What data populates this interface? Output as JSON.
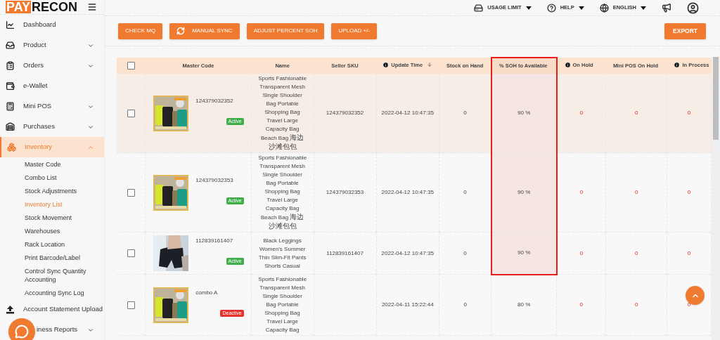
{
  "logo": {
    "part_1": "PAY",
    "part_2": "RECON"
  },
  "topbar": {
    "menus": [
      {
        "label": "USAGE LIMIT"
      },
      {
        "label": "HELP"
      },
      {
        "label": "ENGLISH"
      }
    ]
  },
  "sidebar": {
    "items": [
      {
        "label": "Dashboard",
        "expandable": false,
        "expanded": false,
        "selected": false
      },
      {
        "label": "Product",
        "expandable": true,
        "expanded": false,
        "selected": false
      },
      {
        "label": "Orders",
        "expandable": true,
        "expanded": false,
        "selected": false
      },
      {
        "label": "e-Wallet",
        "expandable": false,
        "expanded": false,
        "selected": false
      },
      {
        "label": "Mini POS",
        "expandable": true,
        "expanded": false,
        "selected": false
      },
      {
        "label": "Purchases",
        "expandable": true,
        "expanded": false,
        "selected": false
      },
      {
        "label": "Inventory",
        "expandable": true,
        "expanded": true,
        "selected": true,
        "children": [
          {
            "label": "Master Code",
            "selected": false
          },
          {
            "label": "Combo List",
            "selected": false
          },
          {
            "label": "Stock Adjustments",
            "selected": false
          },
          {
            "label": "Inventory List",
            "selected": true
          },
          {
            "label": "Stock Movement",
            "selected": false
          },
          {
            "label": "Warehouses",
            "selected": false
          },
          {
            "label": "Rack Location",
            "selected": false
          },
          {
            "label": "Print Barcode/Label",
            "selected": false
          },
          {
            "label": "Control Sync Quantity Accounting",
            "selected": false
          },
          {
            "label": "Accounting Sync Log",
            "selected": false
          }
        ]
      },
      {
        "label": "Account Statement Upload",
        "expandable": false,
        "expanded": false,
        "selected": false
      },
      {
        "label": "iness Reports",
        "expandable": true,
        "expanded": false,
        "selected": false
      }
    ]
  },
  "actions": [
    {
      "label": "CHECK MQ",
      "kind": "plain"
    },
    {
      "label": "MANUAL SYNC",
      "kind": "sync"
    },
    {
      "label": "ADJUST PERCENT SOH",
      "kind": "plain"
    },
    {
      "label": "UPLOAD +/-",
      "kind": "plain"
    }
  ],
  "export_button": "EXPORT",
  "table": {
    "select_all": {
      "checked": false
    },
    "columns": [
      {
        "label": "Master Code",
        "info": false,
        "sorted": false,
        "outlined": false
      },
      {
        "label": "Name",
        "info": false,
        "sorted": false,
        "outlined": false
      },
      {
        "label": "Seller SKU",
        "info": false,
        "sorted": false,
        "outlined": false
      },
      {
        "label": "Update Time",
        "info": true,
        "sorted": true,
        "outlined": false
      },
      {
        "label": "Stock on Hand",
        "info": false,
        "sorted": false,
        "outlined": false
      },
      {
        "label": "% SOH to Available",
        "info": false,
        "sorted": false,
        "outlined": true
      },
      {
        "label": "On Hold",
        "info": true,
        "sorted": false,
        "outlined": false
      },
      {
        "label": "Mini POS On Hold",
        "info": false,
        "sorted": false,
        "outlined": false
      },
      {
        "label": "In Process",
        "info": true,
        "sorted": false,
        "outlined": false
      }
    ],
    "rows": [
      {
        "checked": false,
        "highlighted": true,
        "framed": true,
        "master_code": "124379032352",
        "status": {
          "label": "Active",
          "active": true
        },
        "name": "Sports Fashionable Transparent Mesh Single Shoulder Bag Portable Shopping Bag Travel Large Capacity Bag Beach Bag 海边沙滩包包",
        "seller_sku": "124379032352",
        "update_time": "2022-04-12 10:47:35",
        "stock_on_hand": "0",
        "soh_to_available": "90 %",
        "on_hold": "0",
        "mini_pos_on_hold": "0",
        "in_process": "0"
      },
      {
        "checked": false,
        "highlighted": false,
        "framed": true,
        "master_code": "124379032353",
        "status": {
          "label": "Active",
          "active": true
        },
        "name": "Sports Fashionable Transparent Mesh Single Shoulder Bag Portable Shopping Bag Travel Large Capacity Bag Beach Bag 海边沙滩包包",
        "seller_sku": "124379032353",
        "update_time": "2022-04-12 10:47:35",
        "stock_on_hand": "0",
        "soh_to_available": "90 %",
        "on_hold": "0",
        "mini_pos_on_hold": "0",
        "in_process": "0"
      },
      {
        "checked": false,
        "highlighted": false,
        "framed": true,
        "master_code": "112839161407",
        "status": {
          "label": "Active",
          "active": true
        },
        "name": "Black Leggings Women's Summer Thin Slim-Fit Pants Shorts Casual",
        "seller_sku": "112839161407",
        "update_time": "2022-04-12 10:47:35",
        "stock_on_hand": "0",
        "soh_to_available": "90 %",
        "on_hold": "0",
        "mini_pos_on_hold": "0",
        "in_process": "0"
      },
      {
        "checked": false,
        "highlighted": false,
        "framed": false,
        "master_code": "combo A",
        "status": {
          "label": "Deactive",
          "active": false
        },
        "name": "Sports Fashionable Transparent Mesh Single Shoulder Bag Portable Shopping Bag Travel Large Capacity Bag",
        "seller_sku": "",
        "update_time": "2022-04-11 15:22:44",
        "stock_on_hand": "0",
        "soh_to_available": "80 %",
        "on_hold": "0",
        "mini_pos_on_hold": "0",
        "in_process": "0"
      }
    ]
  }
}
